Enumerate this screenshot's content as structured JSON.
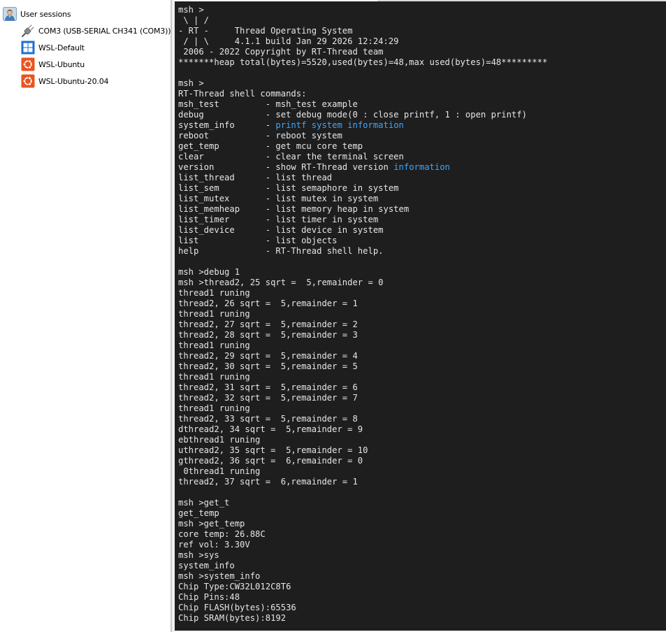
{
  "sessions": {
    "root_label": "User sessions",
    "items": [
      {
        "label": "COM3  (USB-SERIAL CH341 (COM3))",
        "icon": "serial-plug-icon"
      },
      {
        "label": "WSL-Default",
        "icon": "windows-logo-icon"
      },
      {
        "label": "WSL-Ubuntu",
        "icon": "ubuntu-logo-icon"
      },
      {
        "label": "WSL-Ubuntu-20.04",
        "icon": "ubuntu-logo-icon"
      }
    ]
  },
  "colors": {
    "terminal_bg": "#1e1e1e",
    "terminal_fg": "#e6e6e6",
    "highlight": "#3ea6ff",
    "ubuntu_orange": "#e95420",
    "windows_blue": "#1c6fd1"
  },
  "terminal": {
    "lines": [
      "msh >",
      " \\ | /",
      "- RT -     Thread Operating System",
      " / | \\     4.1.1 build Jan 29 2026 12:24:29",
      " 2006 - 2022 Copyright by RT-Thread team",
      "*******heap total(bytes)=5520,used(bytes)=48,max used(bytes)=48*********",
      "",
      "msh >",
      "RT-Thread shell commands:",
      "msh_test         - msh_test example",
      "debug            - set debug mode(0 : close printf, 1 : open printf)",
      "system_info      - printf system information",
      "reboot           - reboot system",
      "get_temp         - get mcu core temp",
      "clear            - clear the terminal screen",
      "version          - show RT-Thread version information",
      "list_thread      - list thread",
      "list_sem         - list semaphore in system",
      "list_mutex       - list mutex in system",
      "list_memheap     - list memory heap in system",
      "list_timer       - list timer in system",
      "list_device      - list device in system",
      "list             - list objects",
      "help             - RT-Thread shell help.",
      "",
      "msh >debug 1",
      "msh >thread2, 25 sqrt =  5,remainder = 0",
      "thread1 runing",
      "thread2, 26 sqrt =  5,remainder = 1",
      "thread1 runing",
      "thread2, 27 sqrt =  5,remainder = 2",
      "thread2, 28 sqrt =  5,remainder = 3",
      "thread1 runing",
      "thread2, 29 sqrt =  5,remainder = 4",
      "thread2, 30 sqrt =  5,remainder = 5",
      "thread1 runing",
      "thread2, 31 sqrt =  5,remainder = 6",
      "thread2, 32 sqrt =  5,remainder = 7",
      "thread1 runing",
      "thread2, 33 sqrt =  5,remainder = 8",
      "dthread2, 34 sqrt =  5,remainder = 9",
      "ebthread1 runing",
      "uthread2, 35 sqrt =  5,remainder = 10",
      "gthread2, 36 sqrt =  6,remainder = 0",
      " 0thread1 runing",
      "thread2, 37 sqrt =  6,remainder = 1",
      "",
      "msh >get_t",
      "get_temp",
      "msh >get_temp",
      "core temp: 26.88C",
      "ref vol: 3.30V",
      "msh >sys",
      "system_info",
      "msh >system_info",
      "Chip Type:CW32L012C8T6",
      "Chip Pins:48",
      "Chip FLASH(bytes):65536",
      "Chip SRAM(bytes):8192"
    ],
    "highlighted_words": [
      "printf system",
      "information"
    ]
  }
}
